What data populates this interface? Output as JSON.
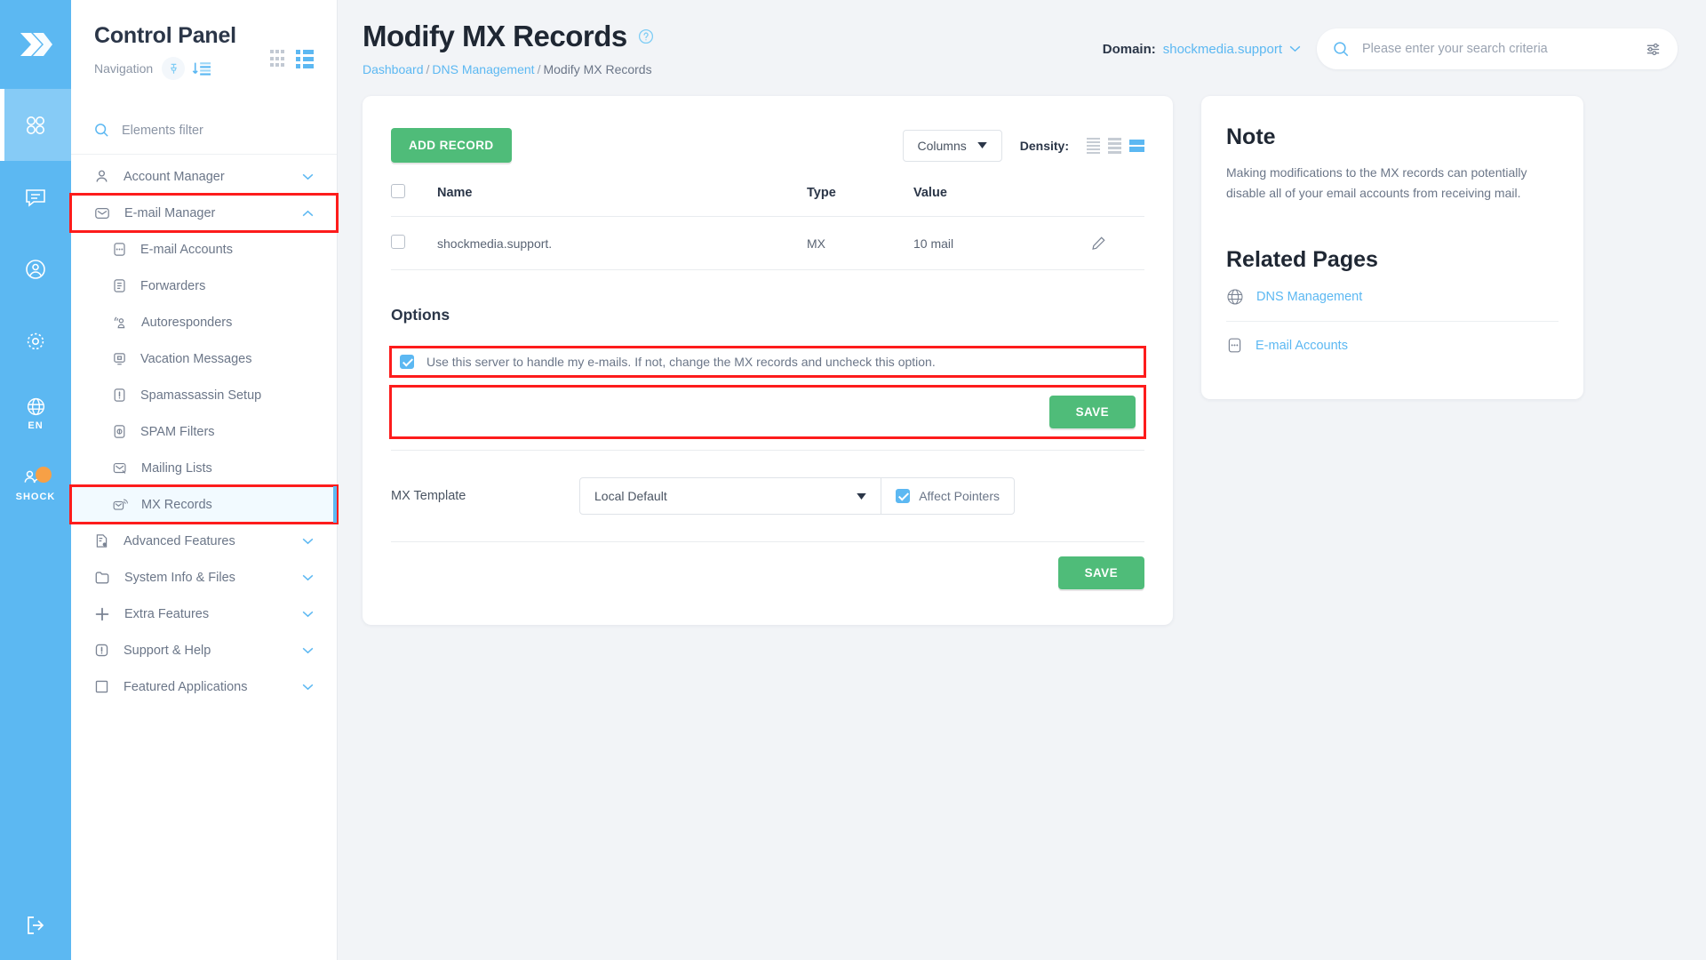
{
  "rail": {
    "logo_icon": "chevrons-right-logo",
    "items": [
      {
        "icon": "apps-grid-icon",
        "name": "apps",
        "label": "",
        "active": true
      },
      {
        "icon": "chat-bubble-icon",
        "name": "messages",
        "label": "",
        "active": false
      },
      {
        "icon": "user-circle-icon",
        "name": "profile",
        "label": "",
        "active": false
      },
      {
        "icon": "gear-icon",
        "name": "settings",
        "label": "",
        "active": false
      },
      {
        "icon": "globe-icon",
        "name": "language",
        "label": "EN",
        "active": false
      },
      {
        "icon": "users-icon",
        "name": "account",
        "label": "SHOCK",
        "active": false
      }
    ],
    "logout_icon": "logout-icon"
  },
  "sidebar": {
    "title": "Control Panel",
    "subtitle": "Navigation",
    "pin_icon": "pin-icon",
    "sort_icon": "sort-descending-icon",
    "grid_view_icon": "grid-view-icon",
    "list_view_icon": "list-view-icon",
    "filter": {
      "icon": "search-icon",
      "placeholder": "Elements filter",
      "value": "Elements filter"
    },
    "items": [
      {
        "label": "Account Manager",
        "icon": "user-icon",
        "expandable": true,
        "expanded": false,
        "level": 0
      },
      {
        "label": "E-mail Manager",
        "icon": "envelope-icon",
        "expandable": true,
        "expanded": true,
        "level": 0,
        "highlighted": true
      },
      {
        "label": "E-mail Accounts",
        "icon": "email-accounts-icon",
        "level": 1
      },
      {
        "label": "Forwarders",
        "icon": "forwarders-icon",
        "level": 1
      },
      {
        "label": "Autoresponders",
        "icon": "autoresponder-icon",
        "level": 1
      },
      {
        "label": "Vacation Messages",
        "icon": "vacation-icon",
        "level": 1
      },
      {
        "label": "Spamassassin Setup",
        "icon": "exclamation-box-icon",
        "level": 1
      },
      {
        "label": "SPAM Filters",
        "icon": "spam-filter-icon",
        "level": 1
      },
      {
        "label": "Mailing Lists",
        "icon": "mailing-list-icon",
        "level": 1
      },
      {
        "label": "MX Records",
        "icon": "mx-records-icon",
        "level": 1,
        "active": true,
        "highlighted": true
      },
      {
        "label": "Advanced Features",
        "icon": "advanced-features-icon",
        "expandable": true,
        "expanded": false,
        "level": 0
      },
      {
        "label": "System Info & Files",
        "icon": "folder-icon",
        "expandable": true,
        "expanded": false,
        "level": 0
      },
      {
        "label": "Extra Features",
        "icon": "plus-icon",
        "expandable": true,
        "expanded": false,
        "level": 0
      },
      {
        "label": "Support & Help",
        "icon": "exclamation-box-icon",
        "expandable": true,
        "expanded": false,
        "level": 0
      },
      {
        "label": "Featured Applications",
        "icon": "square-icon",
        "expandable": true,
        "expanded": false,
        "level": 0
      }
    ]
  },
  "header": {
    "title": "Modify MX Records",
    "help_icon": "help-circle-icon",
    "breadcrumb": [
      {
        "label": "Dashboard",
        "link": true
      },
      {
        "label": "DNS Management",
        "link": true
      },
      {
        "label": "Modify MX Records",
        "link": false
      }
    ],
    "domain_label": "Domain:",
    "domain_value": "shockmedia.support",
    "domain_caret_icon": "chevron-down-icon",
    "search": {
      "icon": "search-icon",
      "placeholder": "Please enter your search criteria",
      "value": "",
      "filter_icon": "sliders-icon"
    }
  },
  "main_card": {
    "add_record_label": "ADD RECORD",
    "columns_label": "Columns",
    "columns_caret_icon": "caret-down-icon",
    "density_label": "Density:",
    "density_options": [
      "compact",
      "standard",
      "comfortable"
    ],
    "density_selected": 2,
    "table": {
      "headers": [
        "Name",
        "Type",
        "Value"
      ],
      "rows": [
        {
          "checked": false,
          "name": "shockmedia.support.",
          "type": "MX",
          "value": "10 mail",
          "edit_icon": "pencil-icon"
        }
      ],
      "header_checkbox_checked": false
    },
    "options_title": "Options",
    "option_checkbox": {
      "checked": true,
      "label": "Use this server to handle my e-mails. If not, change the MX records and uncheck this option."
    },
    "save_label": "SAVE",
    "mx_template_label": "MX Template",
    "mx_template_value": "Local Default",
    "mx_template_caret_icon": "caret-down-icon",
    "affect_pointers_label": "Affect Pointers",
    "affect_pointers_checked": true,
    "save_label_2": "SAVE"
  },
  "side_card": {
    "note_title": "Note",
    "note_body": "Making modifications to the MX records can potentially disable all of your email accounts from receiving mail.",
    "related_title": "Related Pages",
    "related": [
      {
        "label": "DNS Management",
        "icon": "dns-globe-icon"
      },
      {
        "label": "E-mail Accounts",
        "icon": "email-accounts-icon"
      }
    ]
  },
  "colors": {
    "brand_blue": "#5cb8f2",
    "green": "#4fbc79",
    "highlight_red": "#fd1c1c",
    "text_dark": "#2b3648",
    "text_muted": "#6b7688"
  }
}
